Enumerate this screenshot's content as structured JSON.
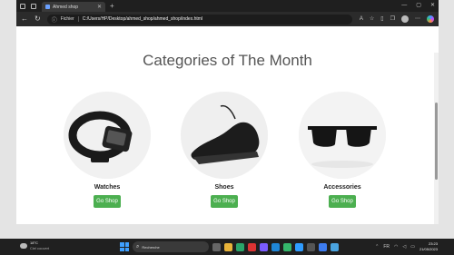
{
  "browser": {
    "tab_title": "Ahmed shop",
    "url_chip": "Fichier",
    "url": "C:/Users/HP/Desktop/ahmed_shop/ahmed_shop/index.html"
  },
  "page": {
    "heading": "Categories of The Month",
    "categories": [
      {
        "label": "Watches",
        "button": "Go Shop"
      },
      {
        "label": "Shoes",
        "button": "Go Shop"
      },
      {
        "label": "Accessories",
        "button": "Go Shop"
      }
    ]
  },
  "taskbar": {
    "weather_temp": "18°C",
    "weather_cond": "Ciel couvert",
    "search_placeholder": "Recherche",
    "time": "23:23",
    "date": "21/05/2023"
  },
  "colors": {
    "accent_button": "#4caf50",
    "browser_chrome": "#2b2b2b",
    "taskbar": "#202020"
  },
  "icons": [
    "back-icon",
    "forward-icon",
    "refresh-icon",
    "info-icon",
    "star-icon",
    "collections-icon",
    "profile-icon",
    "copilot-icon",
    "windows-start-icon",
    "search-icon"
  ]
}
